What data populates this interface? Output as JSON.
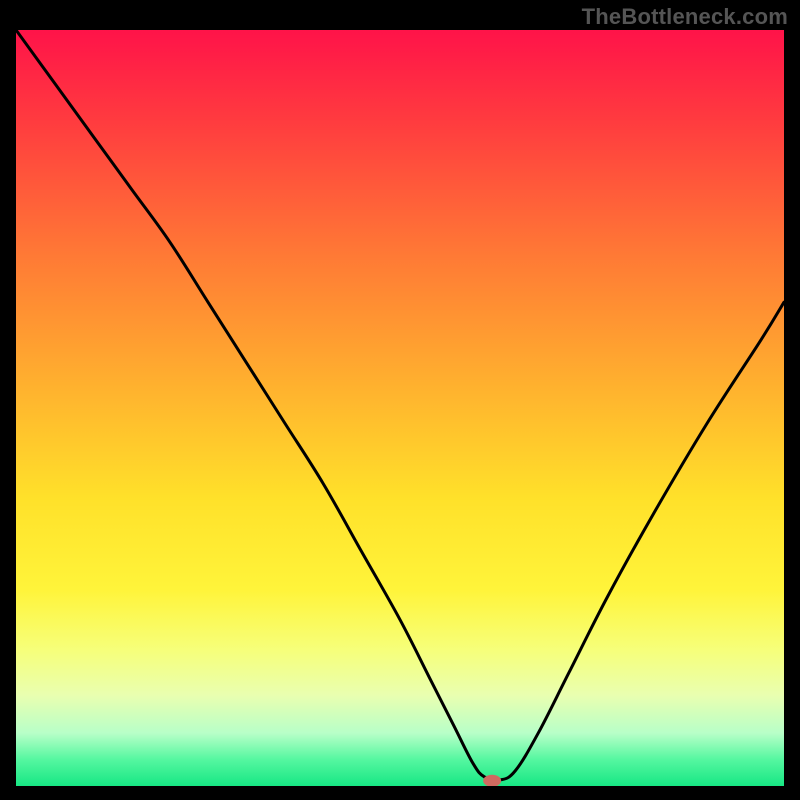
{
  "watermark": "TheBottleneck.com",
  "chart_data": {
    "type": "line",
    "title": "",
    "xlabel": "",
    "ylabel": "",
    "xlim": [
      0,
      100
    ],
    "ylim": [
      0,
      100
    ],
    "grid": false,
    "legend": false,
    "gradient_stops": [
      {
        "offset": 0.0,
        "color": "#ff1349"
      },
      {
        "offset": 0.12,
        "color": "#ff3b3f"
      },
      {
        "offset": 0.3,
        "color": "#ff7a35"
      },
      {
        "offset": 0.48,
        "color": "#ffb42e"
      },
      {
        "offset": 0.62,
        "color": "#ffe12a"
      },
      {
        "offset": 0.74,
        "color": "#fff43a"
      },
      {
        "offset": 0.82,
        "color": "#f6ff7a"
      },
      {
        "offset": 0.88,
        "color": "#e9ffb0"
      },
      {
        "offset": 0.93,
        "color": "#b8ffc8"
      },
      {
        "offset": 0.965,
        "color": "#55f7a0"
      },
      {
        "offset": 1.0,
        "color": "#17e784"
      }
    ],
    "series": [
      {
        "name": "bottleneck-curve",
        "color": "#000000",
        "x": [
          0,
          5,
          10,
          15,
          20,
          25,
          30,
          35,
          40,
          45,
          50,
          54,
          57,
          59.5,
          61,
          63,
          65,
          68,
          72,
          77,
          83,
          90,
          97,
          100
        ],
        "y": [
          100,
          93,
          86,
          79,
          72,
          64,
          56,
          48,
          40,
          31,
          22,
          14,
          8,
          3,
          1.2,
          0.8,
          2,
          7,
          15,
          25,
          36,
          48,
          59,
          64
        ]
      }
    ],
    "marker": {
      "name": "optimal-point",
      "x": 62,
      "y": 0.7,
      "color": "#cf6a60",
      "rx": 9,
      "ry": 6
    }
  }
}
